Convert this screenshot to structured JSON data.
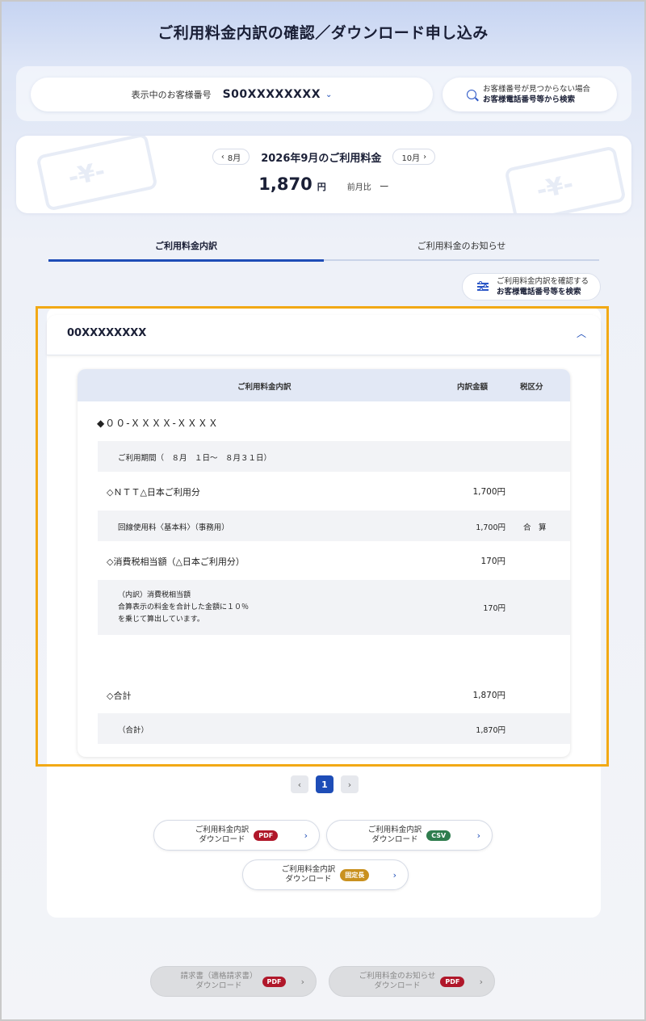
{
  "header": {
    "title": "ご利用料金内訳の確認／ダウンロード申し込み"
  },
  "account": {
    "label": "表示中のお客様番号",
    "number": "S00XXXXXXXX",
    "search_line1": "お客様番号が見つからない場合",
    "search_line2": "お客様電話番号等から検索"
  },
  "billing": {
    "prev_month": "8月",
    "next_month": "10月",
    "title": "2026年9月のご利用料金",
    "amount": "1,870",
    "unit": "円",
    "compare_label": "前月比",
    "compare_value": "ー"
  },
  "tabs": [
    {
      "label": "ご利用料金内訳",
      "active": true
    },
    {
      "label": "ご利用料金のお知らせ",
      "active": false
    }
  ],
  "filter": {
    "line1": "ご利用料金内訳を確認する",
    "line2": "お客様電話番号等を検索"
  },
  "accordion": {
    "number": "00XXXXXXXX"
  },
  "table": {
    "headers": {
      "item": "ご利用料金内訳",
      "amount": "内訳金額",
      "tax": "税区分"
    },
    "rows": [
      {
        "label": "◆００-ＸＸＸＸ-ＸＸＸＸ",
        "amount": "",
        "tax": ""
      },
      {
        "label": "ご利用期間（　８月　１日～　８月３１日）",
        "amount": "",
        "tax": ""
      },
      {
        "label": "◇ＮＴＴ△日本ご利用分",
        "amount": "1,700円",
        "tax": ""
      },
      {
        "label": "回線使用料〈基本料〉（事務用）",
        "amount": "1,700円",
        "tax": "合　算"
      },
      {
        "label": "◇消費税相当額（△日本ご利用分）",
        "amount": "170円",
        "tax": ""
      },
      {
        "label1": "（内訳）消費税相当額",
        "label2": "合算表示の料金を合計した金額に１０％",
        "label3": "を乗じて算出しています。",
        "amount": "170円"
      },
      {
        "label": "◇合計",
        "amount": "1,870円",
        "tax": ""
      },
      {
        "label": "（合計）",
        "amount": "1,870円",
        "tax": ""
      }
    ]
  },
  "pagination": {
    "prev": "‹",
    "current": "1",
    "next": "›"
  },
  "downloads": [
    {
      "line1": "ご利用料金内訳",
      "line2": "ダウンロード",
      "badge": "PDF"
    },
    {
      "line1": "ご利用料金内訳",
      "line2": "ダウンロード",
      "badge": "CSV"
    },
    {
      "line1": "ご利用料金内訳",
      "line2": "ダウンロード",
      "badge": "固定長"
    },
    {
      "line1": "請求書（適格請求書）",
      "line2": "ダウンロード",
      "badge": "PDF"
    },
    {
      "line1": "ご利用料金のお知らせ",
      "line2": "ダウンロード",
      "badge": "PDF"
    }
  ],
  "colors": {
    "accent": "#1e4db7",
    "highlight": "#f2a915",
    "pdf": "#b0172a",
    "csv": "#2f7d4e",
    "fixed": "#c9911f"
  },
  "icons": {
    "search": "search-icon",
    "filter": "sliders-icon",
    "chevron": "chevron-icon",
    "card_decor": "yen-card-icon"
  }
}
